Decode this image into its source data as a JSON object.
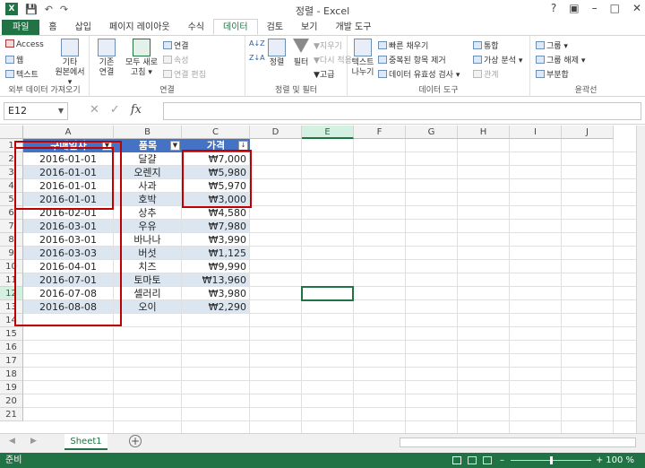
{
  "window": {
    "title": "정렬 - Excel"
  },
  "tabs": [
    "파일",
    "홈",
    "삽입",
    "페이지 레이아웃",
    "수식",
    "데이터",
    "검토",
    "보기",
    "개발 도구"
  ],
  "active_tab": "데이터",
  "ribbon": {
    "external": {
      "label": "외부 데이터 가져오기",
      "access": "Access",
      "web": "웹",
      "text": "텍스트",
      "other": "기타\n원본에서 ▾"
    },
    "connections": {
      "label": "연결",
      "existing": "기존\n연결",
      "refresh": "모두 새로\n고침 ▾",
      "conn": "연결",
      "props": "속성",
      "edit": "연결 편집"
    },
    "sortfilter": {
      "label": "정렬 및 필터",
      "sort": "정렬",
      "filter": "필터",
      "clear": "지우기",
      "reapply": "다시 적용",
      "advanced": "고급"
    },
    "datatools": {
      "label": "데이터 도구",
      "text_to_cols": "텍스트\n나누기",
      "flash": "빠른 채우기",
      "dup": "중복된 항목 제거",
      "validation": "데이터 유효성 검사 ▾",
      "consolidate": "통합",
      "whatif": "가상 분석 ▾",
      "relations": "관계"
    },
    "outline": {
      "label": "윤곽선",
      "group": "그룹 ▾",
      "ungroup": "그룹 해제 ▾",
      "subtotal": "부분합"
    }
  },
  "namebox": "E12",
  "columns": [
    "A",
    "B",
    "C",
    "D",
    "E",
    "F",
    "G",
    "H",
    "I",
    "J"
  ],
  "rows": [
    "1",
    "2",
    "3",
    "4",
    "5",
    "6",
    "7",
    "8",
    "9",
    "10",
    "11",
    "12",
    "13",
    "14",
    "15",
    "16",
    "17",
    "18",
    "19",
    "20",
    "21"
  ],
  "table": {
    "headers": [
      "구매일자",
      "품목",
      "가격"
    ],
    "rows": [
      [
        "2016-01-01",
        "달걀",
        "₩7,000"
      ],
      [
        "2016-01-01",
        "오렌지",
        "₩5,980"
      ],
      [
        "2016-01-01",
        "사과",
        "₩5,970"
      ],
      [
        "2016-01-01",
        "호박",
        "₩3,000"
      ],
      [
        "2016-02-01",
        "상추",
        "₩4,580"
      ],
      [
        "2016-03-01",
        "우유",
        "₩7,980"
      ],
      [
        "2016-03-01",
        "바나나",
        "₩3,990"
      ],
      [
        "2016-03-03",
        "버섯",
        "₩1,125"
      ],
      [
        "2016-04-01",
        "치즈",
        "₩9,990"
      ],
      [
        "2016-07-01",
        "토마토",
        "₩13,960"
      ],
      [
        "2016-07-08",
        "셀러리",
        "₩3,980"
      ],
      [
        "2016-08-08",
        "오이",
        "₩2,290"
      ]
    ]
  },
  "sheet": {
    "name": "Sheet1"
  },
  "status": {
    "ready": "준비",
    "zoom": "100 %"
  },
  "colors": {
    "accent": "#217346",
    "table_header": "#4472c4",
    "band": "#dce6f1",
    "highlight": "#c00000"
  }
}
